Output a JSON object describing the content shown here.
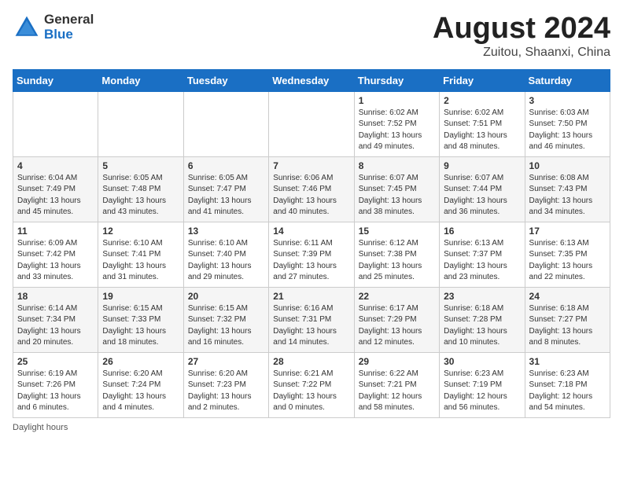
{
  "header": {
    "logo_general": "General",
    "logo_blue": "Blue",
    "title": "August 2024",
    "location": "Zuitou, Shaanxi, China"
  },
  "days_of_week": [
    "Sunday",
    "Monday",
    "Tuesday",
    "Wednesday",
    "Thursday",
    "Friday",
    "Saturday"
  ],
  "weeks": [
    [
      {
        "day": "",
        "detail": ""
      },
      {
        "day": "",
        "detail": ""
      },
      {
        "day": "",
        "detail": ""
      },
      {
        "day": "",
        "detail": ""
      },
      {
        "day": "1",
        "detail": "Sunrise: 6:02 AM\nSunset: 7:52 PM\nDaylight: 13 hours\nand 49 minutes."
      },
      {
        "day": "2",
        "detail": "Sunrise: 6:02 AM\nSunset: 7:51 PM\nDaylight: 13 hours\nand 48 minutes."
      },
      {
        "day": "3",
        "detail": "Sunrise: 6:03 AM\nSunset: 7:50 PM\nDaylight: 13 hours\nand 46 minutes."
      }
    ],
    [
      {
        "day": "4",
        "detail": "Sunrise: 6:04 AM\nSunset: 7:49 PM\nDaylight: 13 hours\nand 45 minutes."
      },
      {
        "day": "5",
        "detail": "Sunrise: 6:05 AM\nSunset: 7:48 PM\nDaylight: 13 hours\nand 43 minutes."
      },
      {
        "day": "6",
        "detail": "Sunrise: 6:05 AM\nSunset: 7:47 PM\nDaylight: 13 hours\nand 41 minutes."
      },
      {
        "day": "7",
        "detail": "Sunrise: 6:06 AM\nSunset: 7:46 PM\nDaylight: 13 hours\nand 40 minutes."
      },
      {
        "day": "8",
        "detail": "Sunrise: 6:07 AM\nSunset: 7:45 PM\nDaylight: 13 hours\nand 38 minutes."
      },
      {
        "day": "9",
        "detail": "Sunrise: 6:07 AM\nSunset: 7:44 PM\nDaylight: 13 hours\nand 36 minutes."
      },
      {
        "day": "10",
        "detail": "Sunrise: 6:08 AM\nSunset: 7:43 PM\nDaylight: 13 hours\nand 34 minutes."
      }
    ],
    [
      {
        "day": "11",
        "detail": "Sunrise: 6:09 AM\nSunset: 7:42 PM\nDaylight: 13 hours\nand 33 minutes."
      },
      {
        "day": "12",
        "detail": "Sunrise: 6:10 AM\nSunset: 7:41 PM\nDaylight: 13 hours\nand 31 minutes."
      },
      {
        "day": "13",
        "detail": "Sunrise: 6:10 AM\nSunset: 7:40 PM\nDaylight: 13 hours\nand 29 minutes."
      },
      {
        "day": "14",
        "detail": "Sunrise: 6:11 AM\nSunset: 7:39 PM\nDaylight: 13 hours\nand 27 minutes."
      },
      {
        "day": "15",
        "detail": "Sunrise: 6:12 AM\nSunset: 7:38 PM\nDaylight: 13 hours\nand 25 minutes."
      },
      {
        "day": "16",
        "detail": "Sunrise: 6:13 AM\nSunset: 7:37 PM\nDaylight: 13 hours\nand 23 minutes."
      },
      {
        "day": "17",
        "detail": "Sunrise: 6:13 AM\nSunset: 7:35 PM\nDaylight: 13 hours\nand 22 minutes."
      }
    ],
    [
      {
        "day": "18",
        "detail": "Sunrise: 6:14 AM\nSunset: 7:34 PM\nDaylight: 13 hours\nand 20 minutes."
      },
      {
        "day": "19",
        "detail": "Sunrise: 6:15 AM\nSunset: 7:33 PM\nDaylight: 13 hours\nand 18 minutes."
      },
      {
        "day": "20",
        "detail": "Sunrise: 6:15 AM\nSunset: 7:32 PM\nDaylight: 13 hours\nand 16 minutes."
      },
      {
        "day": "21",
        "detail": "Sunrise: 6:16 AM\nSunset: 7:31 PM\nDaylight: 13 hours\nand 14 minutes."
      },
      {
        "day": "22",
        "detail": "Sunrise: 6:17 AM\nSunset: 7:29 PM\nDaylight: 13 hours\nand 12 minutes."
      },
      {
        "day": "23",
        "detail": "Sunrise: 6:18 AM\nSunset: 7:28 PM\nDaylight: 13 hours\nand 10 minutes."
      },
      {
        "day": "24",
        "detail": "Sunrise: 6:18 AM\nSunset: 7:27 PM\nDaylight: 13 hours\nand 8 minutes."
      }
    ],
    [
      {
        "day": "25",
        "detail": "Sunrise: 6:19 AM\nSunset: 7:26 PM\nDaylight: 13 hours\nand 6 minutes."
      },
      {
        "day": "26",
        "detail": "Sunrise: 6:20 AM\nSunset: 7:24 PM\nDaylight: 13 hours\nand 4 minutes."
      },
      {
        "day": "27",
        "detail": "Sunrise: 6:20 AM\nSunset: 7:23 PM\nDaylight: 13 hours\nand 2 minutes."
      },
      {
        "day": "28",
        "detail": "Sunrise: 6:21 AM\nSunset: 7:22 PM\nDaylight: 13 hours\nand 0 minutes."
      },
      {
        "day": "29",
        "detail": "Sunrise: 6:22 AM\nSunset: 7:21 PM\nDaylight: 12 hours\nand 58 minutes."
      },
      {
        "day": "30",
        "detail": "Sunrise: 6:23 AM\nSunset: 7:19 PM\nDaylight: 12 hours\nand 56 minutes."
      },
      {
        "day": "31",
        "detail": "Sunrise: 6:23 AM\nSunset: 7:18 PM\nDaylight: 12 hours\nand 54 minutes."
      }
    ]
  ],
  "footer": {
    "daylight_label": "Daylight hours"
  }
}
